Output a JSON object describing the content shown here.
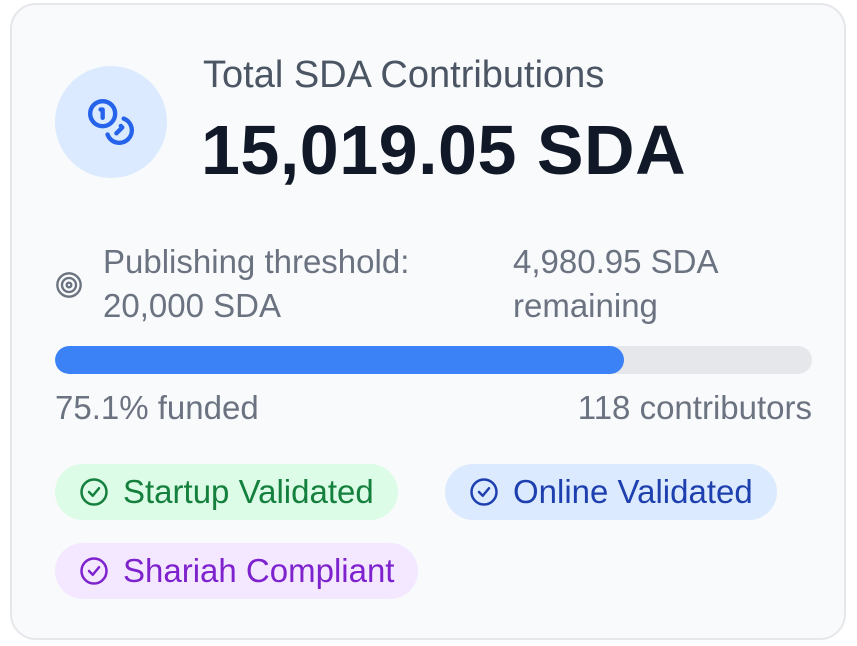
{
  "summary": {
    "title": "Total SDA Contributions",
    "total": "15,019.05 SDA",
    "icon": "coins-icon"
  },
  "threshold": {
    "icon": "target-icon",
    "label": "Publishing threshold: 20,000 SDA",
    "remaining": "4,980.95 SDA remaining"
  },
  "progress": {
    "percent_funded": 75.1,
    "funded_text": "75.1% funded",
    "contributors_text": "118 contributors",
    "fill_color": "#3b82f6",
    "track_color": "#e5e7eb"
  },
  "badges": [
    {
      "label": "Startup Validated",
      "icon": "check-circle-icon",
      "color": "#15803d",
      "bg": "#dcfce7"
    },
    {
      "label": "Online Validated",
      "icon": "check-circle-icon",
      "color": "#1e40af",
      "bg": "#dbeafe"
    },
    {
      "label": "Shariah Compliant",
      "icon": "check-circle-icon",
      "color": "#7e22ce",
      "bg": "#f3e8ff"
    }
  ]
}
